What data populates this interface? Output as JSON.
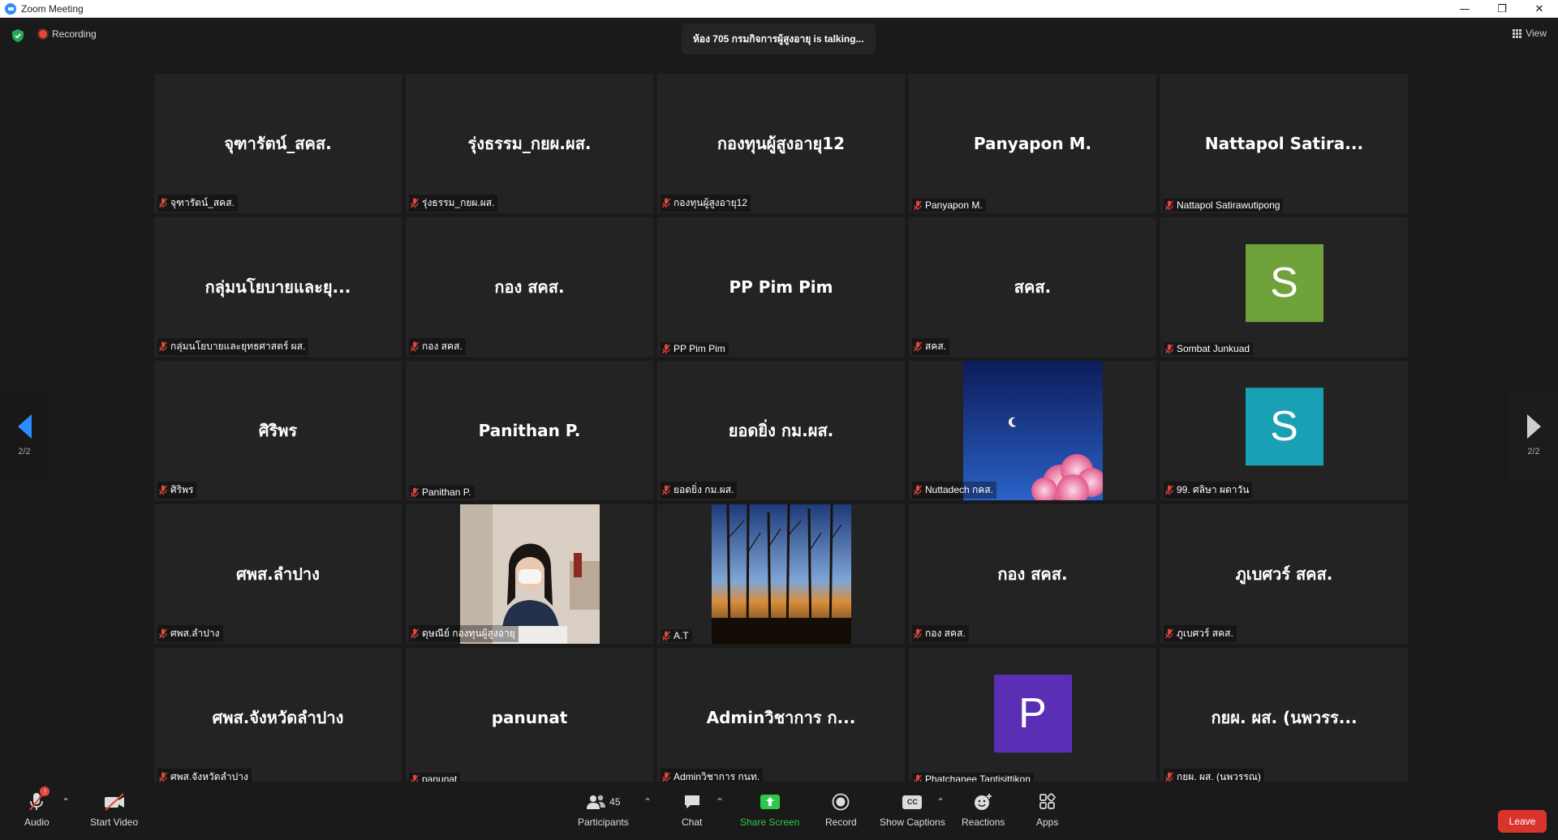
{
  "window": {
    "title": "Zoom Meeting",
    "minimize": "—",
    "restore": "❐",
    "close": "✕"
  },
  "top": {
    "recording": "Recording",
    "talking": "ห้อง 705 กรมกิจการผู้สูงอายุ is talking...",
    "view": "View"
  },
  "nav": {
    "left_page": "2/2",
    "right_page": "2/2"
  },
  "tiles": [
    {
      "name": "จุฑารัตน์_สคส.",
      "label": "จุฑารัตน์_สคส."
    },
    {
      "name": "รุ่งธรรม_กยผ.ผส.",
      "label": "รุ่งธรรม_กยผ.ผส."
    },
    {
      "name": "กองทุนผู้สูงอายุ12",
      "label": "กองทุนผู้สูงอายุ12"
    },
    {
      "name": "Panyapon M.",
      "label": "Panyapon M."
    },
    {
      "name": "Nattapol Satira...",
      "label": "Nattapol Satirawutipong"
    },
    {
      "name": "กลุ่มนโยบายและยุ...",
      "label": "กลุ่มนโยบายและยุทธศาสตร์ ผส."
    },
    {
      "name": "กอง สคส.",
      "label": "กอง สคส."
    },
    {
      "name": "PP Pim Pim",
      "label": "PP Pim Pim"
    },
    {
      "name": "สคส.",
      "label": "สคส."
    },
    {
      "avatar": "S",
      "avatar_color": "#6fa23a",
      "label": "Sombat Junkuad"
    },
    {
      "name": "ศิริพร",
      "label": "ศิริพร"
    },
    {
      "name": "Panithan P.",
      "label": "Panithan P."
    },
    {
      "name": "ยอดยิ่ง กม.ผส.",
      "label": "ยอดยิ่ง กม.ผส."
    },
    {
      "video": "moon-sky",
      "label": "Nuttadech กคส."
    },
    {
      "avatar": "S",
      "avatar_color": "#1aa0b4",
      "label": "99. ศลิษา ผดาวัน"
    },
    {
      "name": "ศพส.ลำปาง",
      "label": "ศพส.ลำปาง"
    },
    {
      "video": "woman-mask",
      "label": "ดุษณีย์ กองทุนผู้สูงอายุ"
    },
    {
      "video": "forest",
      "label": "A.T"
    },
    {
      "name": "กอง สคส.",
      "label": "กอง สคส."
    },
    {
      "name": "ภูเบศวร์ สคส.",
      "label": "ภูเบศวร์ สคส."
    },
    {
      "name": "ศพส.จังหวัดลำปาง",
      "label": "ศพส.จังหวัดลำปาง"
    },
    {
      "name": "panunat",
      "label": "panunat"
    },
    {
      "name": "Adminวิชาการ ก...",
      "label": "Adminวิชาการ กนท."
    },
    {
      "avatar": "P",
      "avatar_color": "#5b2fb5",
      "label": "Phatchanee Tantisittikon"
    },
    {
      "name": "กยผ. ผส. (นพวรร...",
      "label": "กยผ. ผส. (นพวรรณ)"
    }
  ],
  "toolbar": {
    "audio": "Audio",
    "audio_badge": "!",
    "start_video": "Start Video",
    "participants": "Participants",
    "participants_count": "45",
    "chat": "Chat",
    "share_screen": "Share Screen",
    "record": "Record",
    "show_captions": "Show Captions",
    "captions_icon_text": "CC",
    "reactions": "Reactions",
    "apps": "Apps",
    "leave": "Leave"
  }
}
